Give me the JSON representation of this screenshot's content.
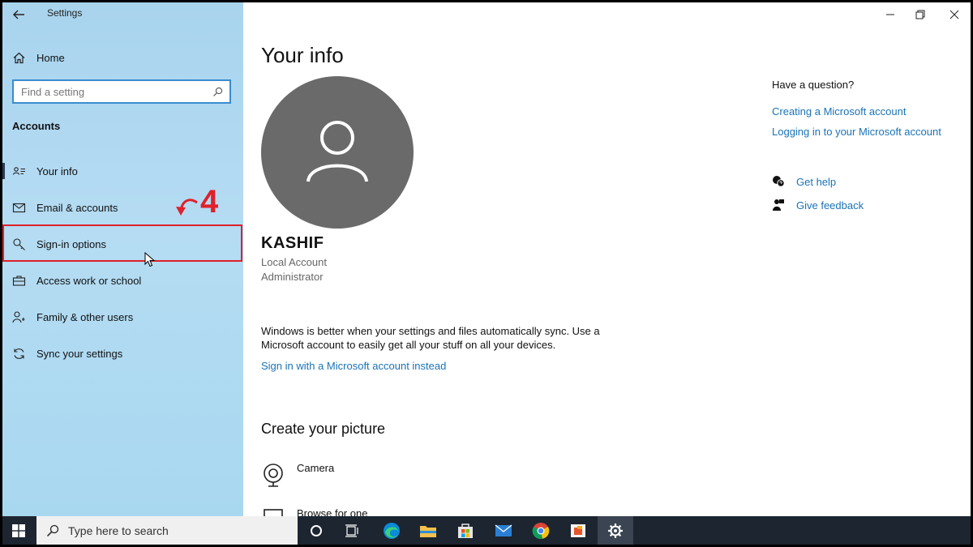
{
  "window": {
    "title": "Settings",
    "controls": [
      "minimize",
      "restore",
      "close"
    ]
  },
  "sidebar": {
    "home_label": "Home",
    "search_placeholder": "Find a setting",
    "section_title": "Accounts",
    "items": [
      {
        "label": "Your info",
        "icon": "person-card-icon",
        "active": true
      },
      {
        "label": "Email & accounts",
        "icon": "mail-icon"
      },
      {
        "label": "Sign-in options",
        "icon": "key-icon",
        "highlighted": true
      },
      {
        "label": "Access work or school",
        "icon": "briefcase-icon"
      },
      {
        "label": "Family & other users",
        "icon": "people-icon"
      },
      {
        "label": "Sync your settings",
        "icon": "sync-icon"
      }
    ]
  },
  "annotation": {
    "step_number": "4",
    "color": "#e0202a"
  },
  "main": {
    "title": "Your info",
    "user_name": "KASHIF",
    "account_type": "Local Account",
    "role": "Administrator",
    "sync_text": "Windows is better when your settings and files automatically sync. Use a Microsoft account to easily get all your stuff on all your devices.",
    "ms_link": "Sign in with a Microsoft account instead",
    "picture_section_title": "Create your picture",
    "picture_options": [
      {
        "label": "Camera",
        "icon": "webcam-icon"
      },
      {
        "label": "Browse for one",
        "icon": "browse-icon"
      }
    ]
  },
  "help": {
    "question": "Have a question?",
    "links": [
      "Creating a Microsoft account",
      "Logging in to your Microsoft account"
    ],
    "get_help": "Get help",
    "give_feedback": "Give feedback"
  },
  "taskbar": {
    "search_placeholder": "Type here to search",
    "apps": [
      "cortana",
      "task-view",
      "edge",
      "file-explorer",
      "store",
      "mail",
      "chrome",
      "office",
      "settings"
    ]
  },
  "colors": {
    "accent_link": "#1a73b6",
    "sidebar_bg": "#b5dcf3",
    "taskbar_bg": "#1c2530",
    "avatar_bg": "#6a6a6a"
  }
}
